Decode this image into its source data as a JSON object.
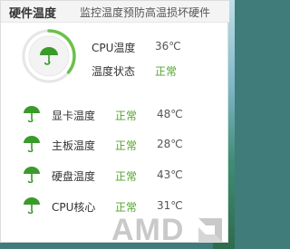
{
  "header": {
    "title": "硬件温度",
    "subtitle": "监控温度预防高温损坏硬件"
  },
  "cpu": {
    "label": "CPU温度",
    "temp": "36℃",
    "state_label": "温度状态",
    "state": "正常",
    "gauge_fraction": 0.36
  },
  "components": [
    {
      "name": "显卡温度",
      "status": "正常",
      "temp": "48℃"
    },
    {
      "name": "主板温度",
      "status": "正常",
      "temp": "28℃"
    },
    {
      "name": "硬盘温度",
      "status": "正常",
      "temp": "43℃"
    },
    {
      "name": "CPU核心",
      "status": "正常",
      "temp": "31℃"
    }
  ],
  "watermark": "AMD",
  "colors": {
    "ok_green": "#52a52a",
    "icon_green": "#3a9a2a",
    "gauge_track": "#e6e6e6"
  },
  "icons": {
    "gauge_center": "umbrella-icon",
    "row": "umbrella-icon"
  }
}
